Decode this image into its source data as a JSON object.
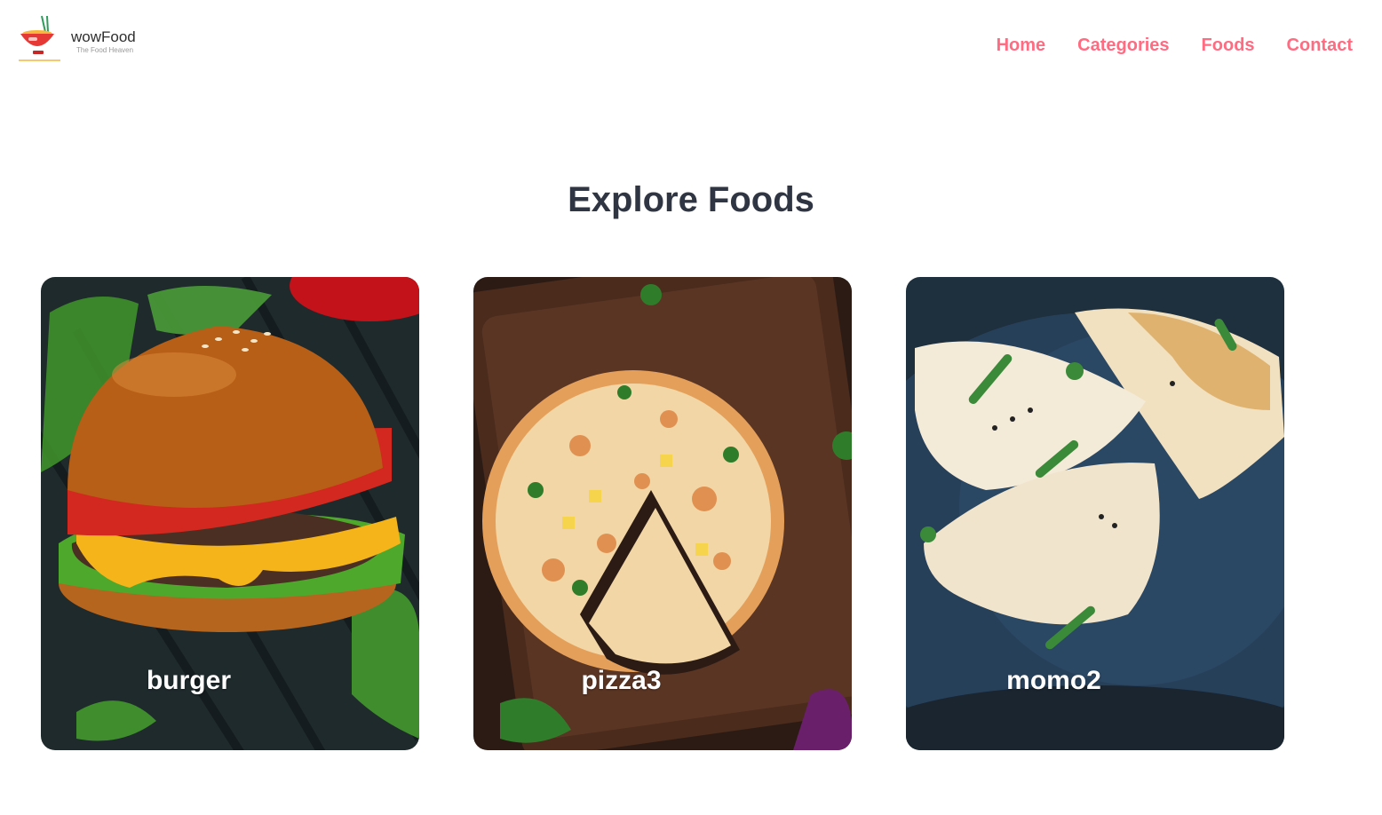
{
  "brand": {
    "name": "wowFood",
    "tagline": "The Food Heaven"
  },
  "nav": {
    "items": [
      {
        "label": "Home"
      },
      {
        "label": "Categories"
      },
      {
        "label": "Foods"
      },
      {
        "label": "Contact"
      }
    ],
    "link_color": "#ff6b81"
  },
  "page": {
    "title": "Explore Foods",
    "title_color": "#2f3542"
  },
  "categories": [
    {
      "label": "burger",
      "icon": "burger-image"
    },
    {
      "label": "pizza3",
      "icon": "pizza-image"
    },
    {
      "label": "momo2",
      "icon": "momo-image"
    }
  ]
}
